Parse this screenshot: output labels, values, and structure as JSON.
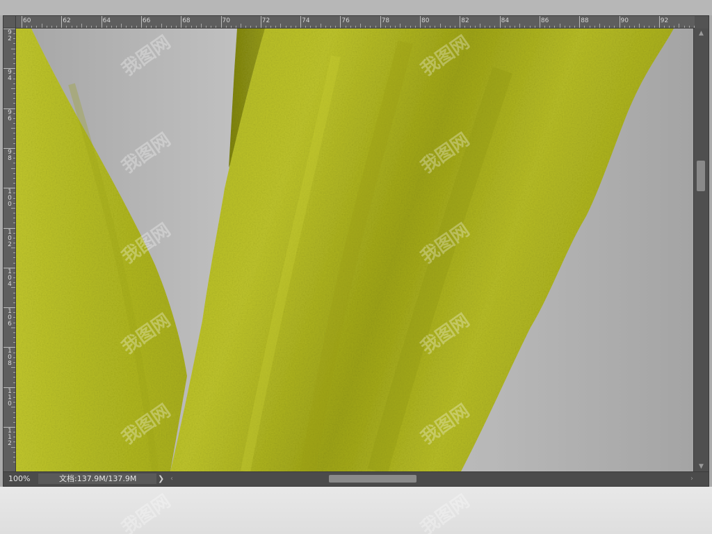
{
  "ruler": {
    "horizontal": [
      "60",
      "62",
      "64",
      "66",
      "68",
      "70",
      "72",
      "74",
      "76",
      "78",
      "80",
      "82",
      "84",
      "86",
      "88",
      "90",
      "92"
    ],
    "vertical": [
      "9\n2",
      "9\n4",
      "9\n6",
      "9\n8",
      "1\n0\n0",
      "1\n0\n2",
      "1\n0\n4",
      "1\n0\n6",
      "1\n0\n8",
      "1\n1\n0",
      "1\n1\n2"
    ]
  },
  "status": {
    "zoom": "100%",
    "doc_info": "文档:137.9M/137.9M",
    "menu_arrow": "❯"
  },
  "colors": {
    "leaf": "#b9bf2a",
    "leaf_dark": "#8f9414",
    "background": "#b4b4b4",
    "app_frame": "#535353"
  },
  "watermark": {
    "text": "我图网"
  },
  "icons": {
    "hscroll_left": "chevron-left-icon",
    "hscroll_right": "chevron-right-icon",
    "vscroll_up": "chevron-up-icon",
    "vscroll_down": "chevron-down-icon"
  }
}
